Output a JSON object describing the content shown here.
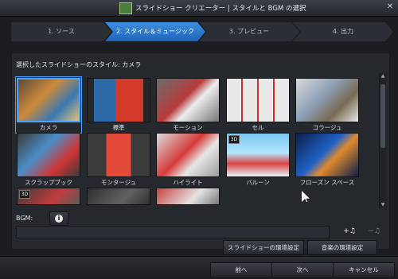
{
  "window": {
    "title": "スライドショー クリエーター | スタイルと BGM の選択",
    "close_glyph": "✕"
  },
  "steps": [
    {
      "label": "1. ソース",
      "active": false
    },
    {
      "label": "2. スタイル＆ミュージック",
      "active": true
    },
    {
      "label": "3. プレビュー",
      "active": false
    },
    {
      "label": "4. 出力",
      "active": false
    }
  ],
  "style_section": {
    "label": "選択したスライドショーのスタイル:",
    "selected_name": "カメラ"
  },
  "styles": [
    {
      "name": "カメラ",
      "selected": true,
      "badge": ""
    },
    {
      "name": "標準",
      "selected": false,
      "badge": ""
    },
    {
      "name": "モーション",
      "selected": false,
      "badge": ""
    },
    {
      "name": "セル",
      "selected": false,
      "badge": ""
    },
    {
      "name": "コラージュ",
      "selected": false,
      "badge": ""
    },
    {
      "name": "スクラップブック",
      "selected": false,
      "badge": ""
    },
    {
      "name": "モンタージュ",
      "selected": false,
      "badge": ""
    },
    {
      "name": "ハイライト",
      "selected": false,
      "badge": ""
    },
    {
      "name": "バルーン",
      "selected": false,
      "badge": "3D"
    },
    {
      "name": "フローズン スペース",
      "selected": false,
      "badge": ""
    },
    {
      "name": "",
      "selected": false,
      "badge": "3D"
    },
    {
      "name": "",
      "selected": false,
      "badge": ""
    },
    {
      "name": "",
      "selected": false,
      "badge": ""
    }
  ],
  "bgm": {
    "label": "BGM:",
    "info_icon": "i",
    "value": "",
    "add_icon": "+♫",
    "remove_icon": "−♫"
  },
  "buttons": {
    "slideshow_settings": "スライドショーの環境設定",
    "music_settings": "音楽の環境設定",
    "back": "前へ",
    "next": "次へ",
    "cancel": "キャンセル"
  }
}
